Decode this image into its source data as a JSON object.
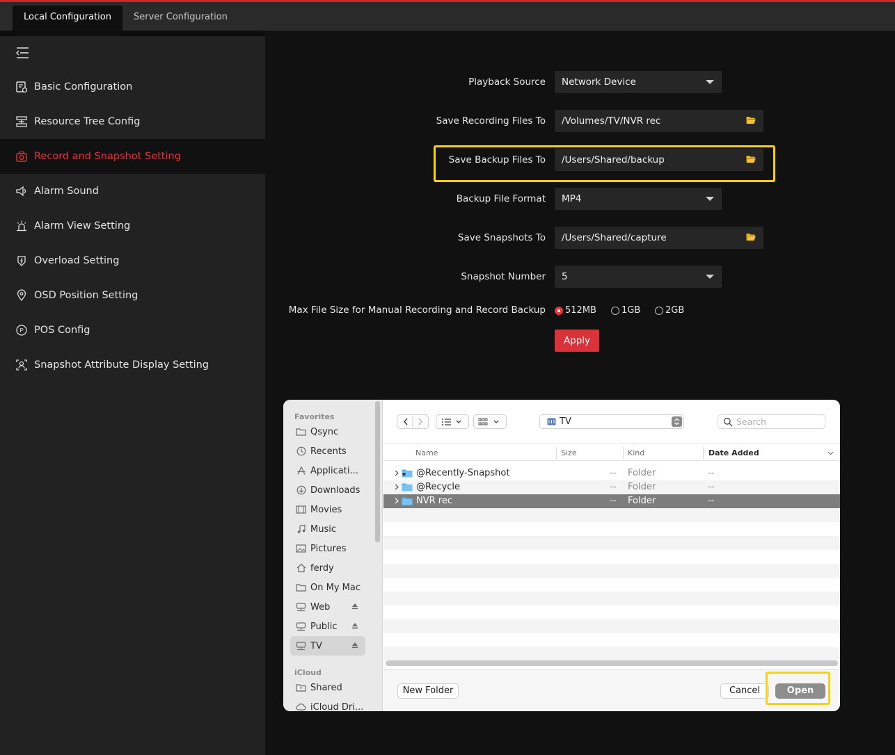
{
  "tabs": [
    {
      "label": "Local Configuration",
      "active": true
    },
    {
      "label": "Server Configuration",
      "active": false
    }
  ],
  "sidebar": {
    "items": [
      {
        "label": "Basic Configuration",
        "icon": "basic-config-icon"
      },
      {
        "label": "Resource Tree Config",
        "icon": "resource-tree-icon"
      },
      {
        "label": "Record and Snapshot Setting",
        "icon": "camera-icon",
        "active": true
      },
      {
        "label": "Alarm Sound",
        "icon": "speaker-icon"
      },
      {
        "label": "Alarm View Setting",
        "icon": "alarm-light-icon"
      },
      {
        "label": "Overload Setting",
        "icon": "overload-icon"
      },
      {
        "label": "OSD Position Setting",
        "icon": "location-pin-icon"
      },
      {
        "label": "POS Config",
        "icon": "pos-icon"
      },
      {
        "label": "Snapshot Attribute Display Setting",
        "icon": "person-frame-icon"
      }
    ]
  },
  "form": {
    "playback_source": {
      "label": "Playback Source",
      "value": "Network Device"
    },
    "save_recording": {
      "label": "Save Recording Files To",
      "value": "/Volumes/TV/NVR rec"
    },
    "save_backup": {
      "label": "Save Backup Files To",
      "value": "/Users/Shared/backup"
    },
    "backup_format": {
      "label": "Backup File Format",
      "value": "MP4"
    },
    "save_snapshots": {
      "label": "Save Snapshots To",
      "value": "/Users/Shared/capture"
    },
    "snapshot_number": {
      "label": "Snapshot Number",
      "value": "5"
    },
    "max_file_size": {
      "label": "Max File Size for Manual Recording and Record Backup",
      "options": [
        "512MB",
        "1GB",
        "2GB"
      ],
      "selected": "512MB"
    },
    "apply_label": "Apply"
  },
  "dialog": {
    "sidebar": {
      "favorites_label": "Favorites",
      "favorites": [
        {
          "label": "Qsync",
          "icon": "folder-icon"
        },
        {
          "label": "Recents",
          "icon": "clock-icon"
        },
        {
          "label": "Applicati...",
          "icon": "applications-icon"
        },
        {
          "label": "Downloads",
          "icon": "download-icon"
        },
        {
          "label": "Movies",
          "icon": "film-icon"
        },
        {
          "label": "Music",
          "icon": "music-note-icon"
        },
        {
          "label": "Pictures",
          "icon": "photo-icon"
        },
        {
          "label": "ferdy",
          "icon": "home-icon"
        },
        {
          "label": "On My Mac",
          "icon": "folder-icon"
        },
        {
          "label": "Web",
          "icon": "network-drive-icon",
          "eject": true
        },
        {
          "label": "Public",
          "icon": "network-drive-icon",
          "eject": true
        },
        {
          "label": "TV",
          "icon": "network-drive-icon",
          "eject": true,
          "selected": true
        }
      ],
      "icloud_label": "iCloud",
      "icloud": [
        {
          "label": "Shared",
          "icon": "shared-folder-icon"
        },
        {
          "label": "iCloud Dri...",
          "icon": "cloud-icon"
        }
      ]
    },
    "location": "TV",
    "search_placeholder": "Search",
    "columns": {
      "name": "Name",
      "size": "Size",
      "kind": "Kind",
      "date_added": "Date Added"
    },
    "files": [
      {
        "name": "@Recently-Snapshot",
        "size": "--",
        "kind": "Folder",
        "date_added": "--"
      },
      {
        "name": "@Recycle",
        "size": "--",
        "kind": "Folder",
        "date_added": "--"
      },
      {
        "name": "NVR rec",
        "size": "--",
        "kind": "Folder",
        "date_added": "--",
        "selected": true
      }
    ],
    "new_folder_label": "New Folder",
    "cancel_label": "Cancel",
    "open_label": "Open"
  },
  "colors": {
    "accent_red": "#e8333a",
    "highlight_yellow": "#f5d21a",
    "folder_icon": "#f2b413"
  }
}
